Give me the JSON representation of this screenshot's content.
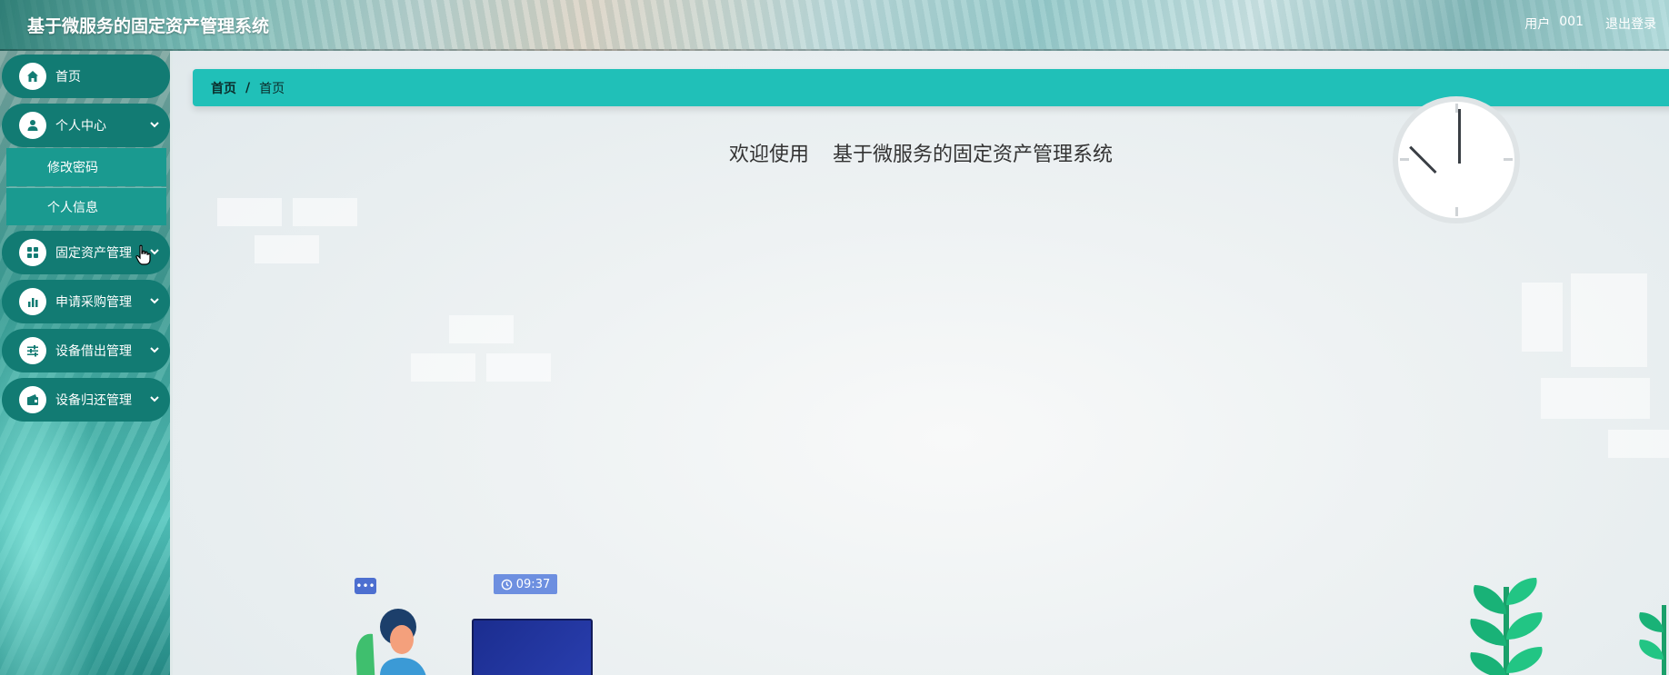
{
  "header": {
    "app_title": "基于微服务的固定资产管理系统",
    "user_label": "用户",
    "user_name": "001",
    "logout_label": "退出登录"
  },
  "sidebar": {
    "items": [
      {
        "label": "首页",
        "icon": "home-icon"
      },
      {
        "label": "个人中心",
        "icon": "user-icon",
        "expanded": true,
        "children": [
          {
            "label": "修改密码"
          },
          {
            "label": "个人信息"
          }
        ]
      },
      {
        "label": "固定资产管理",
        "icon": "grid-icon"
      },
      {
        "label": "申请采购管理",
        "icon": "bar-chart-icon"
      },
      {
        "label": "设备借出管理",
        "icon": "sliders-icon"
      },
      {
        "label": "设备归还管理",
        "icon": "wallet-icon"
      }
    ]
  },
  "breadcrumb": {
    "home": "首页",
    "separator": "/",
    "current": "首页"
  },
  "main": {
    "welcome_prefix": "欢迎使用",
    "welcome_system": "基于微服务的固定资产管理系统",
    "illustration_time": "09:37",
    "chat_dots": "•••"
  },
  "colors": {
    "accent": "#20c0b8",
    "menu_bg": "#127b73",
    "submenu_bg": "#1a9a90"
  }
}
